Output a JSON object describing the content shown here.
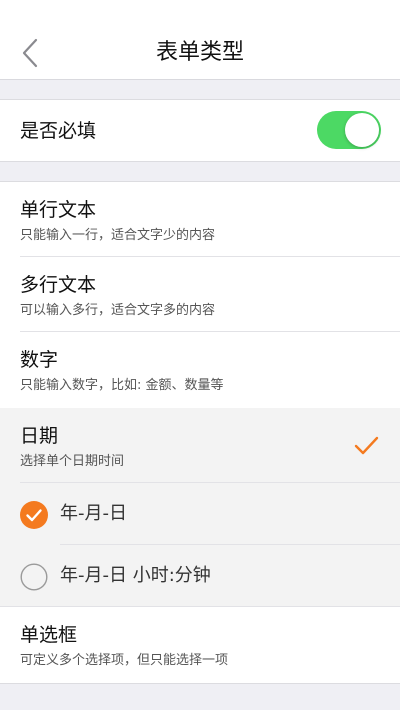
{
  "nav": {
    "title": "表单类型",
    "back_icon": "chevron-left-icon"
  },
  "required": {
    "label": "是否必填",
    "toggle_on": true,
    "toggle_color": "#4cd964"
  },
  "types": [
    {
      "name": "单行文本",
      "desc": "只能输入一行，适合文字少的内容"
    },
    {
      "name": "多行文本",
      "desc": "可以输入多行，适合文字多的内容"
    },
    {
      "name": "数字",
      "desc": "只能输入数字，比如: 金额、数量等"
    },
    {
      "name": "日期",
      "desc": "选择单个日期时间",
      "selected": true
    },
    {
      "name": "单选框",
      "desc": "可定义多个选择项，但只能选择一项"
    }
  ],
  "date_formats": [
    {
      "label": "年-月-日",
      "checked": true
    },
    {
      "label": "年-月-日 小时:分钟",
      "checked": false
    }
  ],
  "accent_color": "#f47a1f"
}
